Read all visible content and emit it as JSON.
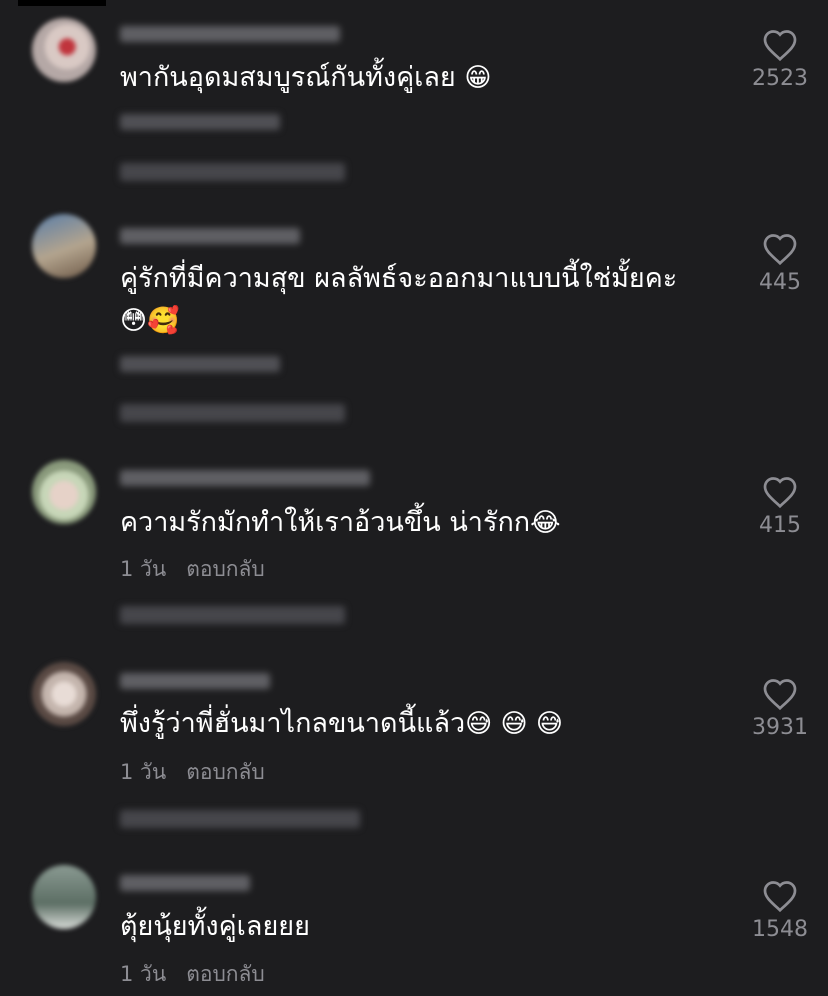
{
  "comments": [
    {
      "text": "พากันอุดมสมบูรณ์กันทั้งคู่เลย",
      "emoji": "😁",
      "likes": "2523",
      "meta_time": "",
      "meta_reply": "",
      "avatar_colors": [
        "#b5a8a6",
        "#d9c9c4",
        "#c0343c"
      ]
    },
    {
      "text": "คู่รักที่มีความสุข ผลลัพธ์จะออกมาแบบนี้ใช่มั้ยคะ",
      "emoji": "😳🥰",
      "likes": "445",
      "meta_time": "",
      "meta_reply": "",
      "avatar_colors": [
        "#5a7ea8",
        "#b3a48e",
        "#6e5a48"
      ]
    },
    {
      "text": "ความรักมักทำให้เราอ้วนขึ้น น่ารักก",
      "emoji": "😂",
      "likes": "415",
      "meta_time": "1 วัน",
      "meta_reply": "ตอบกลับ",
      "avatar_colors": [
        "#c7d6b8",
        "#e6d2c8",
        "#8a9a7c"
      ]
    },
    {
      "text": "พึ่งรู้ว่าพี่ฮั่นมาไกลขนาดนี้แล้ว",
      "emoji": "😅 😅 😅",
      "likes": "3931",
      "meta_time": "1 วัน",
      "meta_reply": "ตอบกลับ",
      "avatar_colors": [
        "#c4b5ad",
        "#e8dcd6",
        "#5a4a44"
      ]
    },
    {
      "text": "ตุ้ยนุ้ยทั้งคู่เลยยย",
      "emoji": "",
      "likes": "1548",
      "meta_time": "1 วัน",
      "meta_reply": "ตอบกลับ",
      "avatar_colors": [
        "#5c6e64",
        "#8a9a92",
        "#d8dcd8"
      ]
    }
  ]
}
